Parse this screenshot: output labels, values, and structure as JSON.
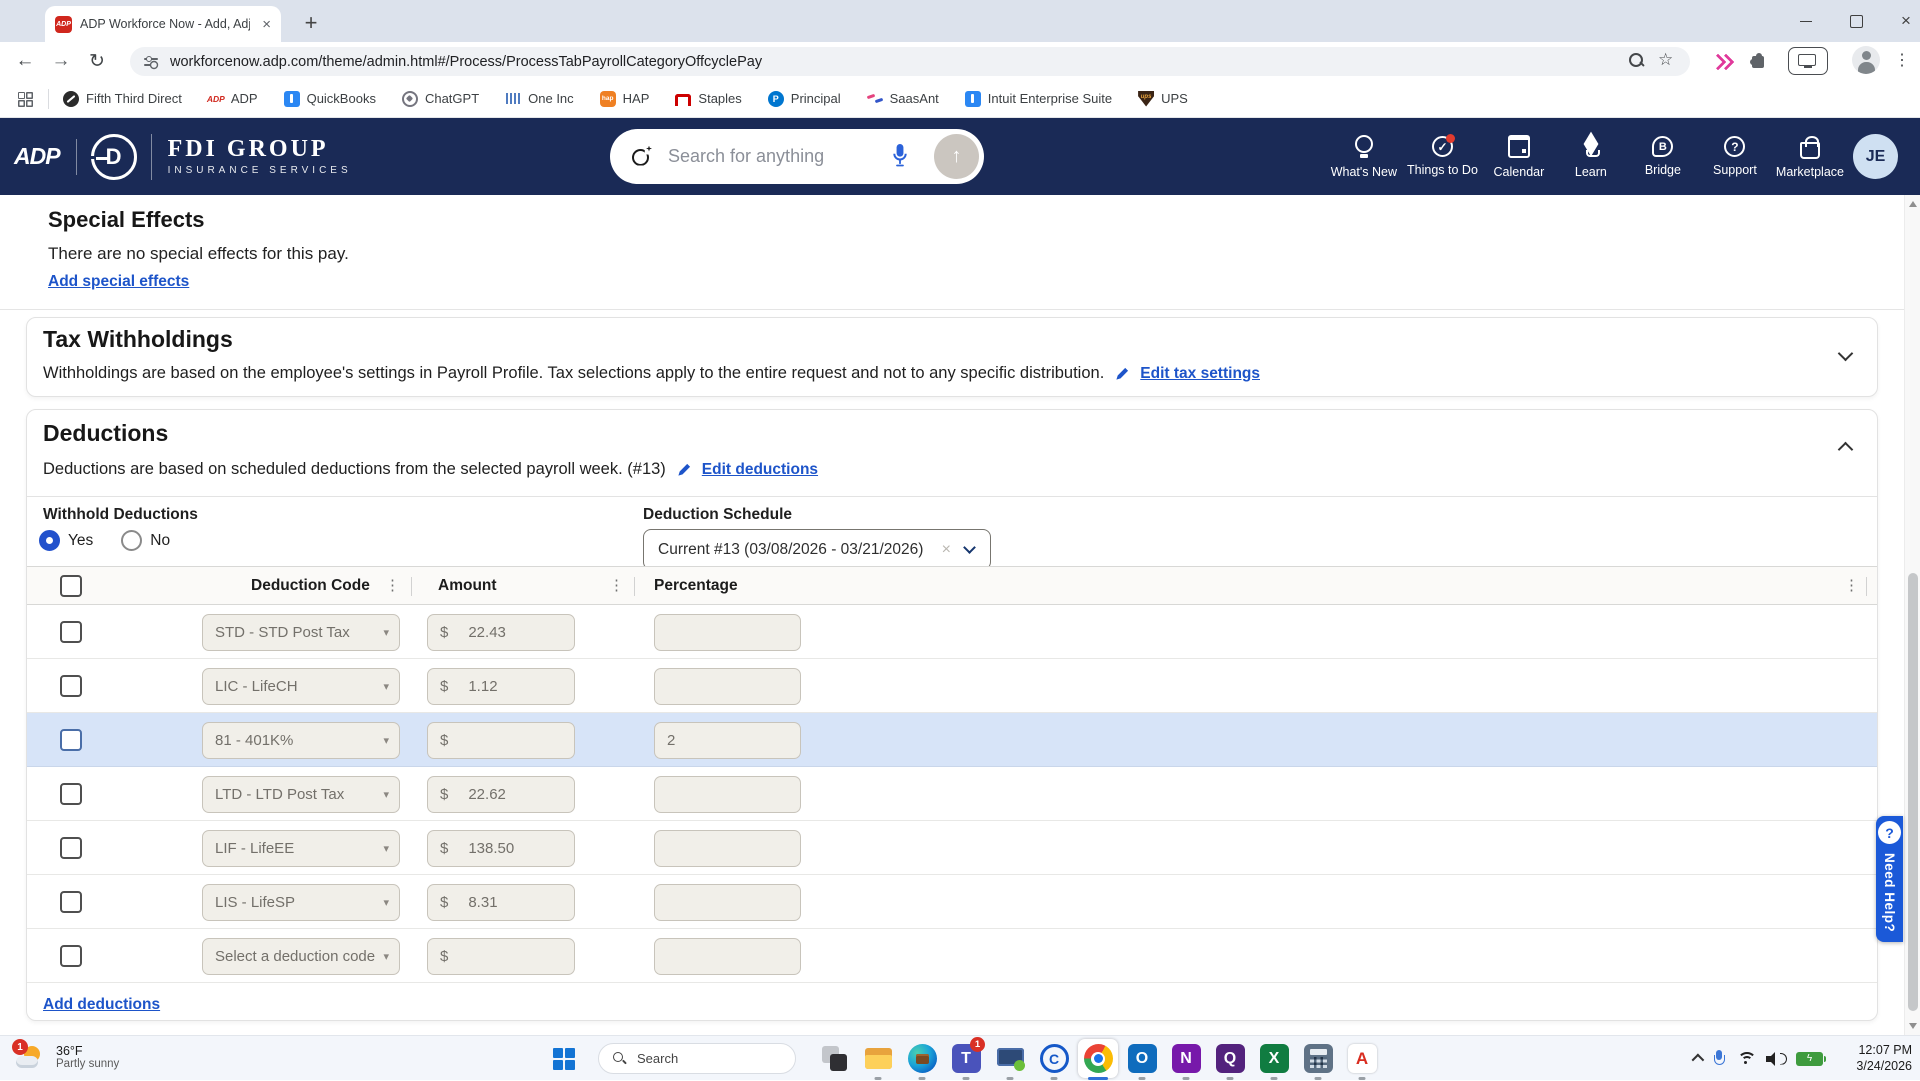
{
  "browser": {
    "tab": {
      "title": "ADP Workforce Now - Add, Adj",
      "close_glyph": "×",
      "new_tab_glyph": "+"
    },
    "toolbar": {
      "url": "workforcenow.adp.com/theme/admin.html#/Process/ProcessTabPayrollCategoryOffcyclePay"
    },
    "bookmarks": [
      {
        "label": "Fifth Third Direct",
        "icon": "fifth-third"
      },
      {
        "label": "ADP",
        "icon": "adp"
      },
      {
        "label": "QuickBooks",
        "icon": "quickbooks"
      },
      {
        "label": "ChatGPT",
        "icon": "chatgpt"
      },
      {
        "label": "One Inc",
        "icon": "one-inc"
      },
      {
        "label": "HAP",
        "icon": "hap"
      },
      {
        "label": "Staples",
        "icon": "staples"
      },
      {
        "label": "Principal",
        "icon": "principal"
      },
      {
        "label": "SaasAnt",
        "icon": "saasant"
      },
      {
        "label": "Intuit Enterprise Suite",
        "icon": "intuit"
      },
      {
        "label": "UPS",
        "icon": "ups"
      }
    ]
  },
  "header": {
    "logo_text": "ADP",
    "brand": {
      "name": "FDI GROUP",
      "tagline": "INSURANCE SERVICES",
      "monogram": "D"
    },
    "search": {
      "placeholder": "Search for anything",
      "submit_glyph": "↑"
    },
    "nav": [
      {
        "label": "What's New",
        "icon": "whats-new"
      },
      {
        "label": "Things to Do",
        "icon": "things-to-do",
        "badge_dot": true
      },
      {
        "label": "Calendar",
        "icon": "calendar"
      },
      {
        "label": "Learn",
        "icon": "learn"
      },
      {
        "label": "Bridge",
        "icon": "bridge"
      },
      {
        "label": "Support",
        "icon": "support"
      },
      {
        "label": "Marketplace",
        "icon": "marketplace"
      }
    ],
    "avatar": "JE"
  },
  "special_effects": {
    "title": "Special Effects",
    "description": "There are no special effects for this pay.",
    "add_link": "Add special effects"
  },
  "tax_withholdings": {
    "title": "Tax Withholdings",
    "description": "Withholdings are based on the employee's settings in Payroll Profile. Tax selections apply to the entire request and not to any specific distribution.",
    "edit_link": "Edit tax settings"
  },
  "deductions": {
    "title": "Deductions",
    "description": "Deductions are based on scheduled deductions from the selected payroll week. (#13)",
    "edit_link": "Edit deductions",
    "withhold": {
      "label": "Withhold Deductions",
      "options": [
        {
          "label": "Yes",
          "selected": true
        },
        {
          "label": "No",
          "selected": false
        }
      ]
    },
    "schedule": {
      "label": "Deduction Schedule",
      "value": "Current #13 (03/08/2026 - 03/21/2026)",
      "clear_glyph": "×"
    },
    "table": {
      "columns": [
        "Deduction Code",
        "Amount",
        "Percentage"
      ],
      "currency_symbol": "$",
      "kebab_glyph": "⋮",
      "caret_glyph": "▾",
      "rows": [
        {
          "code": "STD - STD Post Tax",
          "amount": "22.43",
          "percentage": ""
        },
        {
          "code": "LIC - LifeCH",
          "amount": "1.12",
          "percentage": ""
        },
        {
          "code": "81 - 401K%",
          "amount": "",
          "percentage": "2",
          "highlighted": true
        },
        {
          "code": "LTD - LTD Post Tax",
          "amount": "22.62",
          "percentage": ""
        },
        {
          "code": "LIF - LifeEE",
          "amount": "138.50",
          "percentage": ""
        },
        {
          "code": "LIS - LifeSP",
          "amount": "8.31",
          "percentage": ""
        },
        {
          "code": "Select a deduction code",
          "amount": "",
          "percentage": ""
        }
      ]
    },
    "add_link": "Add deductions"
  },
  "need_help": {
    "label": "Need Help?",
    "badge": "?"
  },
  "taskbar": {
    "weather": {
      "badge": "1",
      "temp": "36°F",
      "condition": "Partly sunny"
    },
    "search_label": "Search",
    "apps": [
      {
        "icon": "task-view"
      },
      {
        "icon": "file-explorer"
      },
      {
        "icon": "edge"
      },
      {
        "icon": "teams",
        "badge": "1"
      },
      {
        "icon": "remote-desktop"
      },
      {
        "icon": "c-app"
      },
      {
        "icon": "chrome",
        "active": true
      },
      {
        "icon": "outlook"
      },
      {
        "icon": "onenote"
      },
      {
        "icon": "quickbooks-desktop"
      },
      {
        "icon": "excel"
      },
      {
        "icon": "calculator"
      },
      {
        "icon": "acrobat"
      }
    ],
    "clock": {
      "time": "12:07 PM",
      "date": "3/24/2026"
    }
  }
}
